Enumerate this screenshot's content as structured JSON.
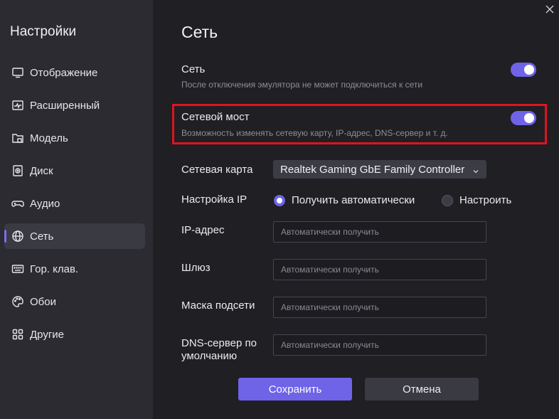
{
  "sidebar": {
    "title": "Настройки",
    "items": [
      {
        "label": "Отображение",
        "icon": "monitor-icon"
      },
      {
        "label": "Расширенный",
        "icon": "pulse-icon"
      },
      {
        "label": "Модель",
        "icon": "folder-icon"
      },
      {
        "label": "Диск",
        "icon": "disk-icon"
      },
      {
        "label": "Аудио",
        "icon": "gamepad-icon"
      },
      {
        "label": "Сеть",
        "icon": "globe-icon",
        "active": true
      },
      {
        "label": "Гор. клав.",
        "icon": "keyboard-icon"
      },
      {
        "label": "Обои",
        "icon": "palette-icon"
      },
      {
        "label": "Другие",
        "icon": "grid-icon"
      }
    ]
  },
  "main": {
    "title": "Сеть",
    "network": {
      "title": "Сеть",
      "desc": "После отключения эмулятора не может подключиться к сети",
      "enabled": true
    },
    "bridge": {
      "title": "Сетевой мост",
      "desc": "Возможность изменять сетевую карту, IP-адрес, DNS-сервер и т. д.",
      "enabled": true
    },
    "adapter": {
      "label": "Сетевая карта",
      "value": "Realtek Gaming GbE Family Controller"
    },
    "ip_setting": {
      "label": "Настройка IP",
      "options": [
        "Получить автоматически",
        "Настроить"
      ],
      "selected": "Получить автоматически"
    },
    "fields": {
      "ip": {
        "label": "IP-адрес",
        "placeholder": "Автоматически получить"
      },
      "gateway": {
        "label": "Шлюз",
        "placeholder": "Автоматически получить"
      },
      "mask": {
        "label": "Маска подсети",
        "placeholder": "Автоматически получить"
      },
      "dns": {
        "label": "DNS-сервер по умолчанию",
        "placeholder": "Автоматически получить"
      }
    },
    "buttons": {
      "save": "Сохранить",
      "cancel": "Отмена"
    }
  },
  "colors": {
    "accent": "#6f63e8",
    "highlight": "#e1121f",
    "sidebar_bg": "#2b2b31",
    "main_bg": "#1f1f24"
  }
}
